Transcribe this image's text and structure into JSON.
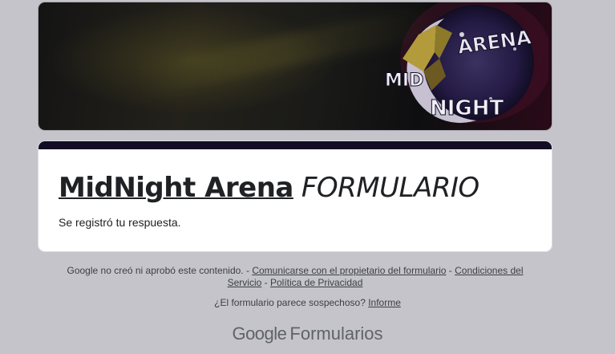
{
  "banner": {
    "logo_text_top": "ARENA",
    "logo_text_mid": "MID",
    "logo_text_bottom": "NIGHT"
  },
  "form": {
    "title_bold": "MidNight Arena",
    "title_italic": "FORMULARIO",
    "confirmation": "Se registró tu respuesta.",
    "accent_color": "#120d24"
  },
  "footer": {
    "disclaimer_prefix": "Google no creó ni aprobó este contenido. - ",
    "contact_owner_link": "Comunicarse con el propietario del formulario",
    "sep1": " - ",
    "terms_link": "Condiciones del Servicio",
    "sep2": " - ",
    "privacy_link": "Política de Privacidad",
    "suspicious_text": "¿El formulario parece sospechoso? ",
    "report_link": "Informe"
  },
  "brand": {
    "google": "Google",
    "product": "Formularios"
  }
}
